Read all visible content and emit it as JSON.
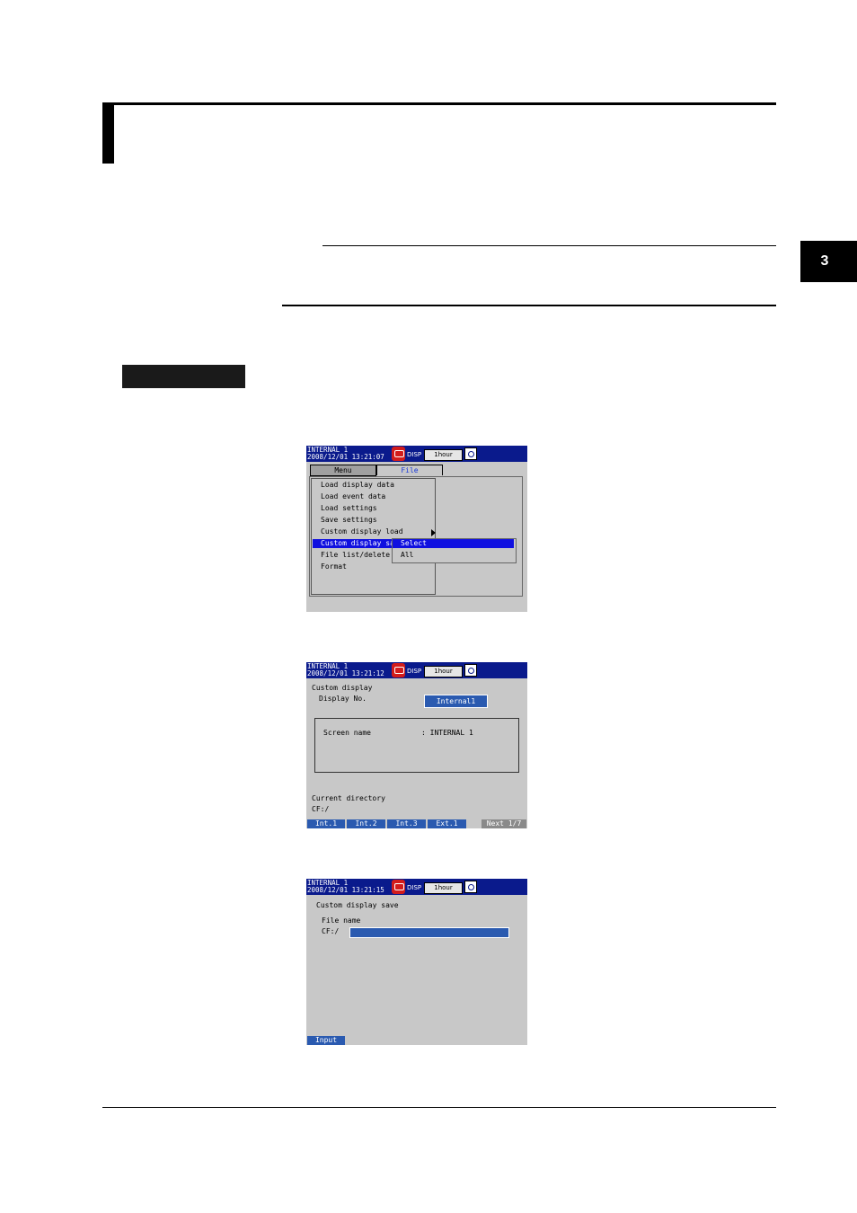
{
  "tab": {
    "chapter": "3"
  },
  "screen1": {
    "line1": "INTERNAL 1",
    "line2": "2008/12/01 13:21:07",
    "disp": "DISP",
    "hour": "1hour",
    "tabs": [
      "Menu",
      "File"
    ],
    "menu": [
      "Load display data",
      "Load event data",
      "Load settings",
      "Save settings",
      "Custom display load",
      "Custom display sa",
      "File list/delete",
      "Format"
    ],
    "submenu": [
      "Select",
      "All"
    ]
  },
  "screen2": {
    "line1": "INTERNAL 1",
    "line2": "2008/12/01 13:21:12",
    "disp": "DISP",
    "hour": "1hour",
    "title": "Custom display",
    "display_no_label": "Display No.",
    "display_no_value": "Internal1",
    "screen_name_label": "Screen name",
    "screen_name_value": ": INTERNAL 1",
    "dir_label": "Current directory",
    "dir_value": "CF:/",
    "softkeys": [
      "Int.1",
      "Int.2",
      "Int.3",
      "Ext.1",
      "Next 1/7"
    ]
  },
  "screen3": {
    "line1": "INTERNAL 1",
    "line2": "2008/12/01 13:21:15",
    "disp": "DISP",
    "hour": "1hour",
    "title": "Custom display save",
    "file_label": "File name",
    "file_prefix": "CF:/",
    "softkeys": [
      "Input"
    ]
  }
}
